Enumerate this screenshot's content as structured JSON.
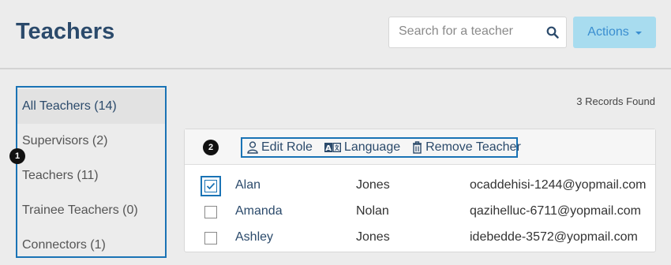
{
  "header": {
    "title": "Teachers",
    "search_placeholder": "Search for a teacher",
    "actions_label": "Actions"
  },
  "sidebar": {
    "marker": "1",
    "items": [
      {
        "label": "All Teachers (14)"
      },
      {
        "label": "Supervisors (2)"
      },
      {
        "label": "Teachers (11)"
      },
      {
        "label": "Trainee Teachers (0)"
      },
      {
        "label": "Connectors (1)"
      }
    ]
  },
  "records_found": "3 Records Found",
  "toolbar": {
    "marker": "2",
    "edit_role": "Edit Role",
    "language": "Language",
    "remove_teacher": "Remove Teacher"
  },
  "table": {
    "rows": [
      {
        "first": "Alan",
        "last": "Jones",
        "email": "ocaddehisi-1244@yopmail.com",
        "checked": true
      },
      {
        "first": "Amanda",
        "last": "Nolan",
        "email": "qazihelluc-6711@yopmail.com",
        "checked": false
      },
      {
        "first": "Ashley",
        "last": "Jones",
        "email": "idebedde-3572@yopmail.com",
        "checked": false
      }
    ]
  },
  "colors": {
    "accent": "#1a73b5",
    "title": "#2b4a6b",
    "actions_bg": "#a8dcef",
    "actions_text": "#3a8ed0"
  },
  "icons": {
    "search": "search-icon",
    "caret": "chevron-down-icon",
    "edit_role": "person-icon",
    "language": "language-icon",
    "remove": "trash-icon",
    "check": "checkmark-icon"
  }
}
